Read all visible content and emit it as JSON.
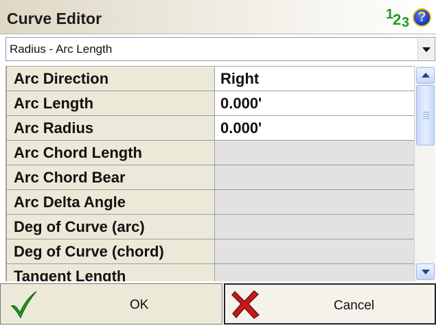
{
  "window": {
    "title": "Curve Editor",
    "number_format_icon": "number-format-icon",
    "help_icon": "help-icon",
    "help_glyph": "?"
  },
  "dropdown": {
    "selected": "Radius - Arc Length",
    "arrow_icon": "chevron-down-icon"
  },
  "grid": {
    "rows": [
      {
        "label": "Arc Direction",
        "value": "Right",
        "editable": true
      },
      {
        "label": "Arc Length",
        "value": "0.000'",
        "editable": true
      },
      {
        "label": "Arc Radius",
        "value": "0.000'",
        "editable": true
      },
      {
        "label": "Arc Chord Length",
        "value": "",
        "editable": false
      },
      {
        "label": "Arc Chord Bear",
        "value": "",
        "editable": false
      },
      {
        "label": "Arc Delta Angle",
        "value": "",
        "editable": false
      },
      {
        "label": "Deg of Curve (arc)",
        "value": "",
        "editable": false
      },
      {
        "label": "Deg of Curve (chord)",
        "value": "",
        "editable": false
      },
      {
        "label": "Tangent Length",
        "value": "",
        "editable": false
      }
    ]
  },
  "buttons": {
    "ok_label": "OK",
    "cancel_label": "Cancel"
  },
  "colors": {
    "label_bg": "#ece9d8",
    "disabled_bg": "#e2e2e2",
    "ok_check": "#22a622",
    "cancel_x": "#c41a1a"
  }
}
